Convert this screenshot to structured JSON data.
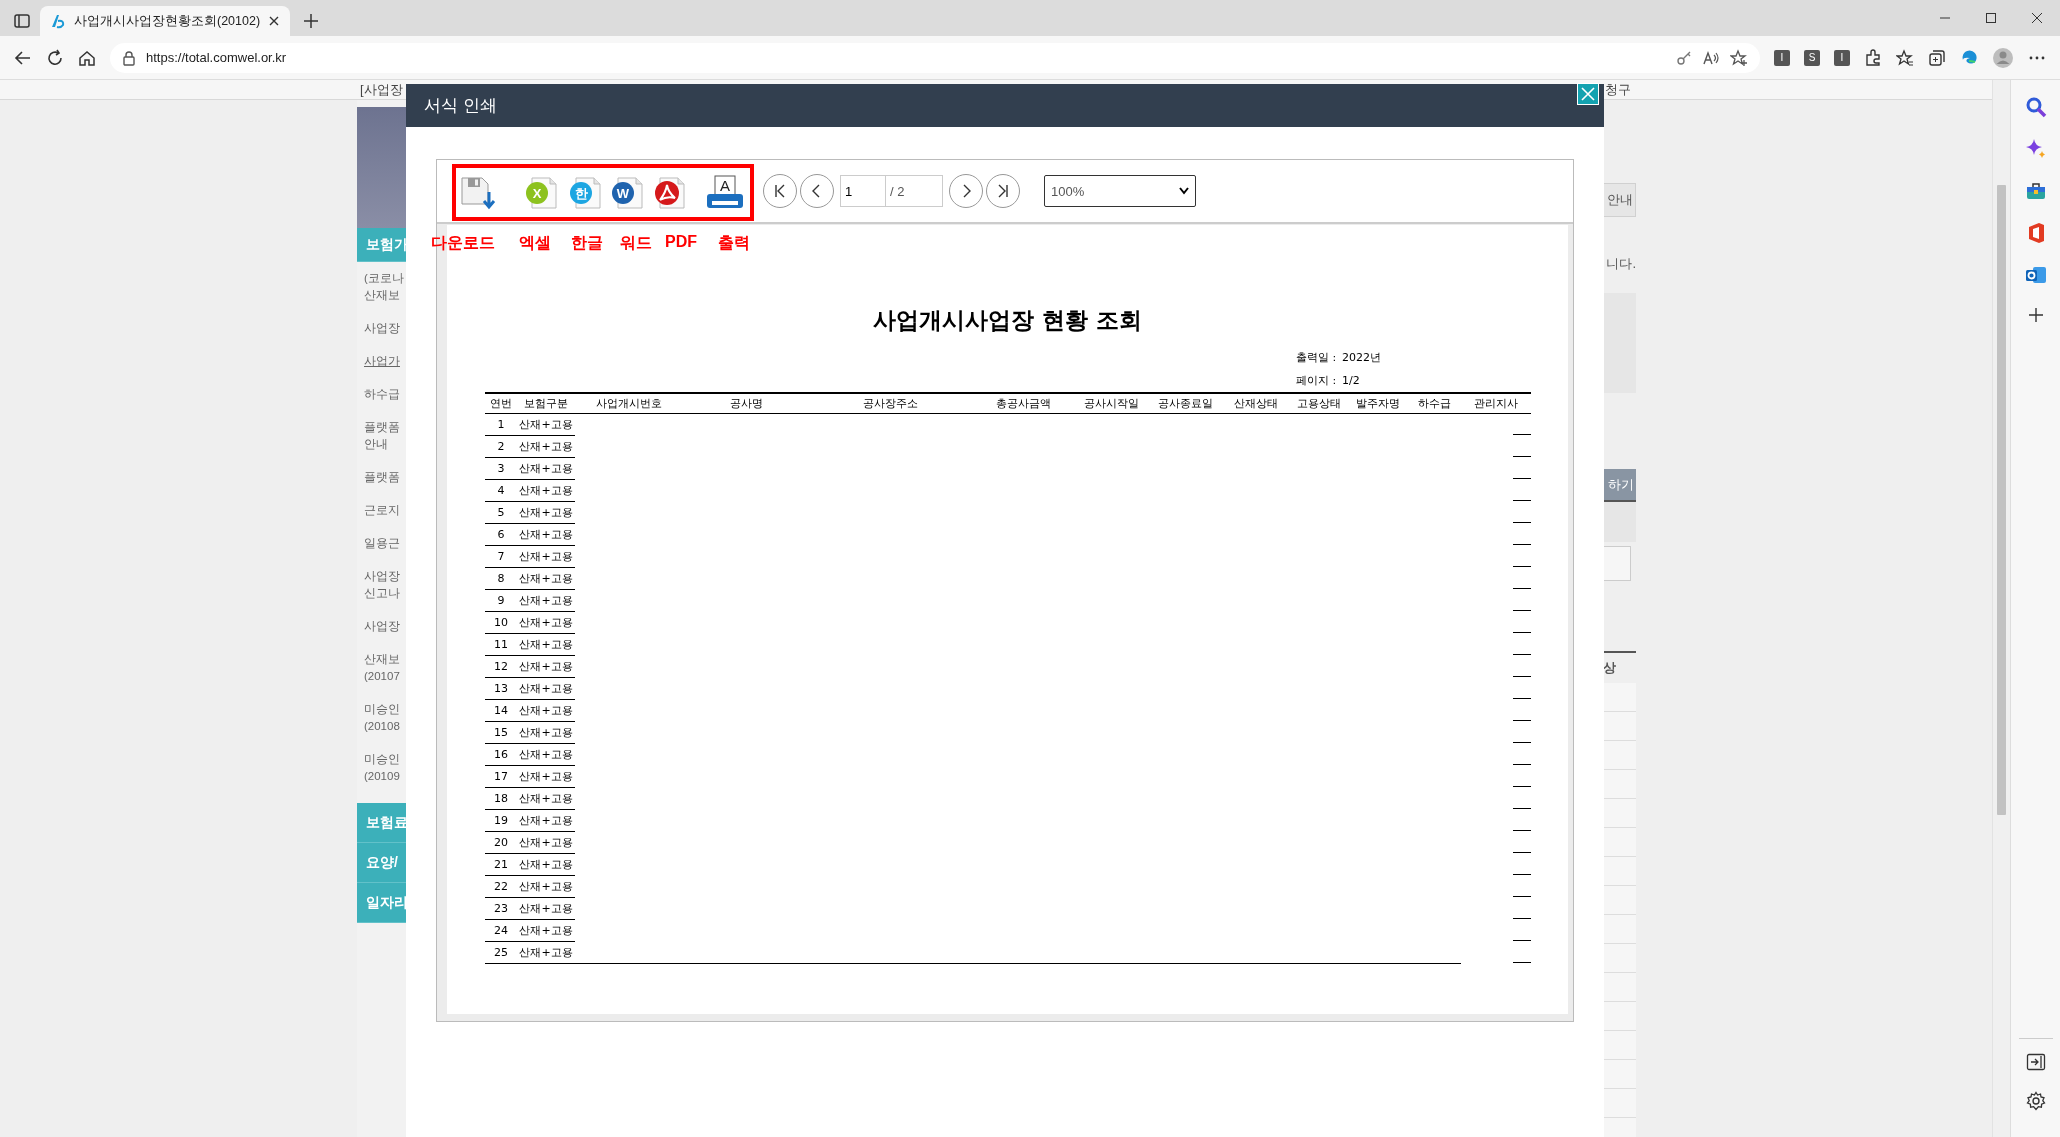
{
  "browser": {
    "tab": {
      "title": "사업개시사업장현황조회(20102)",
      "selected": true
    },
    "url": "https://total.comwel.or.kr",
    "extensions": [
      "I",
      "S",
      "I"
    ]
  },
  "background_page": {
    "top_nav": [
      "[사업장",
      "청구"
    ],
    "sidebar": [
      {
        "kind": "header",
        "text": "보험가"
      },
      {
        "kind": "link",
        "text": "(코로나\n산재보",
        "selected": false
      },
      {
        "kind": "link",
        "text": "사업장",
        "selected": false
      },
      {
        "kind": "link",
        "text": "사업가",
        "selected": true
      },
      {
        "kind": "link",
        "text": "하수급",
        "selected": false
      },
      {
        "kind": "link",
        "text": "플랫폼\n안내",
        "selected": false
      },
      {
        "kind": "link",
        "text": "플랫폼",
        "selected": false
      },
      {
        "kind": "link",
        "text": "근로지",
        "selected": false
      },
      {
        "kind": "link",
        "text": "일용근",
        "selected": false
      },
      {
        "kind": "link",
        "text": "사업장\n신고나",
        "selected": false
      },
      {
        "kind": "link",
        "text": "사업장",
        "selected": false
      },
      {
        "kind": "link",
        "text": "산재보\n(20107",
        "selected": false
      },
      {
        "kind": "link",
        "text": "미승인\n(20108",
        "selected": false
      },
      {
        "kind": "link",
        "text": "미승인\n(20109",
        "selected": false
      },
      {
        "kind": "header",
        "text": "보험료"
      },
      {
        "kind": "header",
        "text": "요양/"
      },
      {
        "kind": "header",
        "text": "일자리"
      }
    ],
    "right_panel": {
      "guide_button": "안내",
      "note": "니다.",
      "action_button": "하기",
      "table_header": "상"
    }
  },
  "print_dialog": {
    "title": "서식 인쇄",
    "export_buttons": [
      {
        "kind": "download",
        "label": "다운로드"
      },
      {
        "kind": "excel",
        "label": "엑셀",
        "icon_text": "X"
      },
      {
        "kind": "hwp",
        "label": "한글",
        "icon_text": "한"
      },
      {
        "kind": "word",
        "label": "워드",
        "icon_text": "W"
      },
      {
        "kind": "pdf",
        "label": "PDF"
      },
      {
        "kind": "print",
        "label": "출력",
        "icon_text": "A"
      }
    ],
    "page_field": {
      "value": "1",
      "total": "/ 2"
    },
    "zoom": "100%",
    "report": {
      "title": "사업개시사업장 현황 조회",
      "meta": [
        {
          "label": "출력일 :",
          "value": "2022년"
        },
        {
          "label": "페이지 :",
          "value": "1/2"
        }
      ],
      "columns": [
        "연번",
        "보험구분",
        "사업개시번호",
        "공사명",
        "공사장주소",
        "총공사금액",
        "공사시작일",
        "공사종료일",
        "산재상태",
        "고용상태",
        "발주자명",
        "하수급",
        "관리지사"
      ],
      "rows": [
        {
          "no": "1",
          "insurance_type": "산재+고용"
        },
        {
          "no": "2",
          "insurance_type": "산재+고용"
        },
        {
          "no": "3",
          "insurance_type": "산재+고용"
        },
        {
          "no": "4",
          "insurance_type": "산재+고용"
        },
        {
          "no": "5",
          "insurance_type": "산재+고용"
        },
        {
          "no": "6",
          "insurance_type": "산재+고용"
        },
        {
          "no": "7",
          "insurance_type": "산재+고용"
        },
        {
          "no": "8",
          "insurance_type": "산재+고용"
        },
        {
          "no": "9",
          "insurance_type": "산재+고용"
        },
        {
          "no": "10",
          "insurance_type": "산재+고용"
        },
        {
          "no": "11",
          "insurance_type": "산재+고용"
        },
        {
          "no": "12",
          "insurance_type": "산재+고용"
        },
        {
          "no": "13",
          "insurance_type": "산재+고용"
        },
        {
          "no": "14",
          "insurance_type": "산재+고용"
        },
        {
          "no": "15",
          "insurance_type": "산재+고용"
        },
        {
          "no": "16",
          "insurance_type": "산재+고용"
        },
        {
          "no": "17",
          "insurance_type": "산재+고용"
        },
        {
          "no": "18",
          "insurance_type": "산재+고용"
        },
        {
          "no": "19",
          "insurance_type": "산재+고용"
        },
        {
          "no": "20",
          "insurance_type": "산재+고용"
        },
        {
          "no": "21",
          "insurance_type": "산재+고용"
        },
        {
          "no": "22",
          "insurance_type": "산재+고용"
        },
        {
          "no": "23",
          "insurance_type": "산재+고용"
        },
        {
          "no": "24",
          "insurance_type": "산재+고용"
        },
        {
          "no": "25",
          "insurance_type": "산재+고용"
        }
      ]
    }
  }
}
